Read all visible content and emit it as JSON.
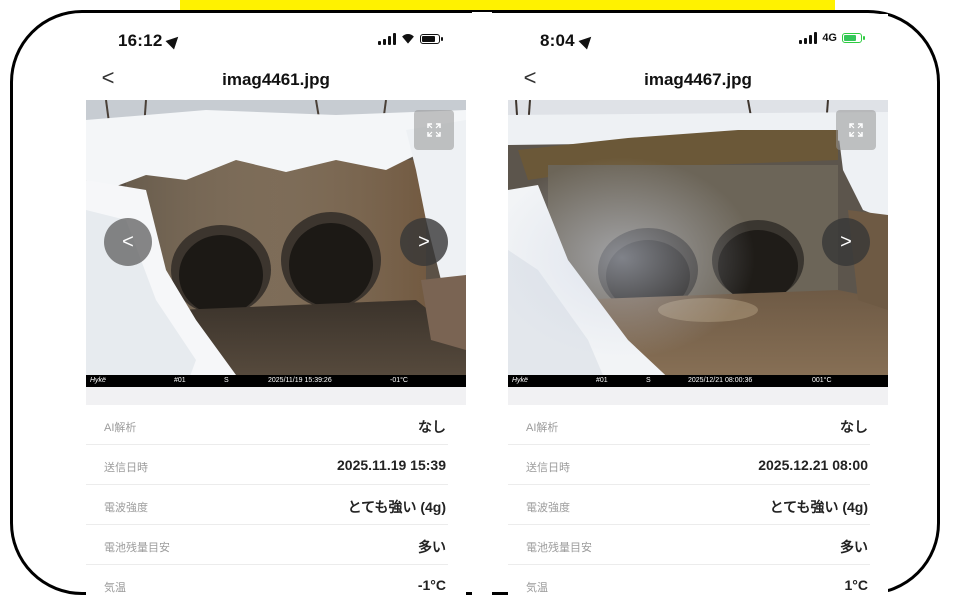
{
  "phones": [
    {
      "status": {
        "time": "16:12",
        "network": "",
        "battery_color": "#111111"
      },
      "nav": {
        "back": "<",
        "title": "imag4461.jpg"
      },
      "photo": {
        "prev": "<",
        "next": ">",
        "stamp": {
          "brand": "Hykë",
          "cam": "#01",
          "mode": "S",
          "datetime": "2025/11/19 15:39:26",
          "temp": "-01°C"
        }
      },
      "info": [
        {
          "label": "AI解析",
          "value": "なし"
        },
        {
          "label": "送信日時",
          "value": "2025.11.19 15:39"
        },
        {
          "label": "電波強度",
          "value": "とても強い (4g)"
        },
        {
          "label": "電池残量目安",
          "value": "多い"
        },
        {
          "label": "気温",
          "value": "-1°C"
        }
      ]
    },
    {
      "status": {
        "time": "8:04",
        "network": "4G",
        "battery_color": "#34c759"
      },
      "nav": {
        "back": "<",
        "title": "imag4467.jpg"
      },
      "photo": {
        "prev": "",
        "next": ">",
        "stamp": {
          "brand": "Hykë",
          "cam": "#01",
          "mode": "S",
          "datetime": "2025/12/21 08:00:36",
          "temp": "001°C"
        }
      },
      "info": [
        {
          "label": "AI解析",
          "value": "なし"
        },
        {
          "label": "送信日時",
          "value": "2025.12.21 08:00"
        },
        {
          "label": "電波強度",
          "value": "とても強い (4g)"
        },
        {
          "label": "電池残量目安",
          "value": "多い"
        },
        {
          "label": "気温",
          "value": "1°C"
        }
      ]
    }
  ],
  "colors": {
    "highlight": "#fff200",
    "frame": "#000000",
    "label_gray": "#9c9c9c"
  }
}
